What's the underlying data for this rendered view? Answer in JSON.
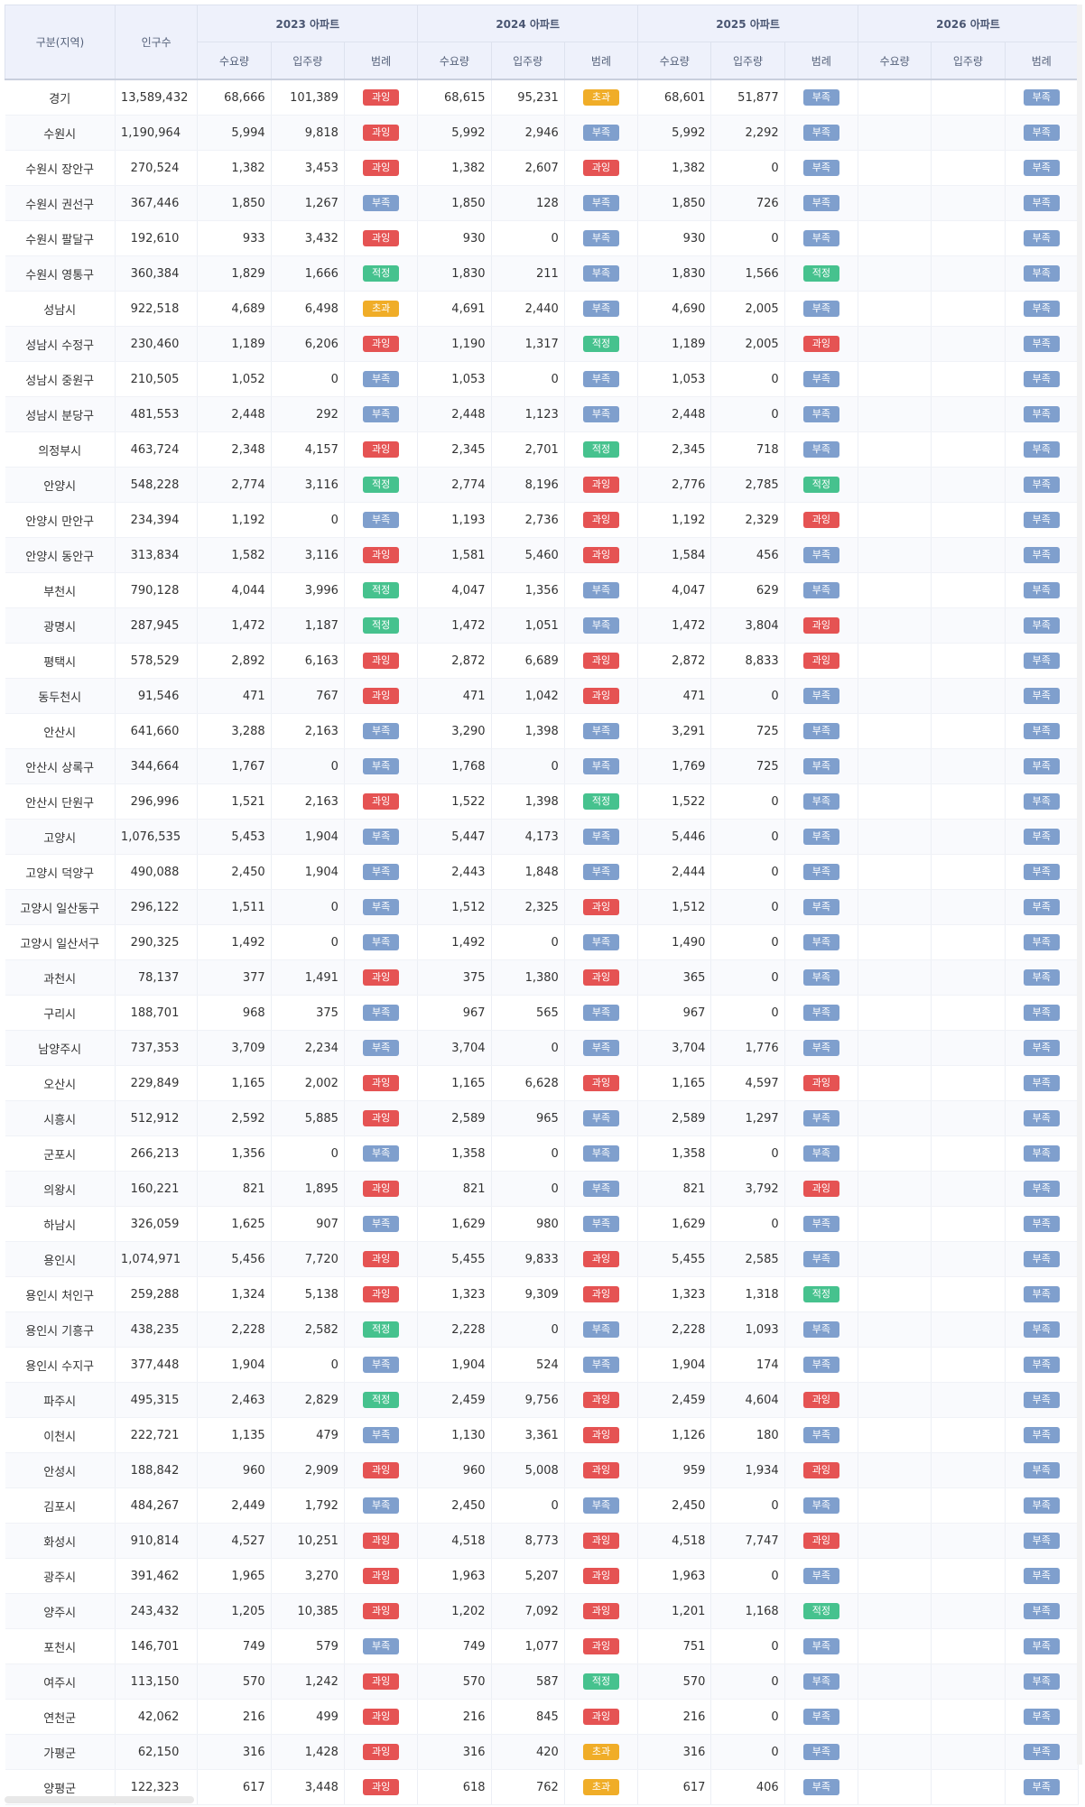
{
  "header": {
    "region": "구분(지역)",
    "population": "인구수",
    "years": [
      "2023 아파트",
      "2024 아파트",
      "2025 아파트",
      "2026 아파트"
    ],
    "sub": [
      "수요량",
      "입주량",
      "범례"
    ]
  },
  "legend_colors": {
    "과잉": "#e55353",
    "초과": "#f0ad28",
    "부족": "#7f9fcd",
    "적정": "#46c28e"
  },
  "rows": [
    [
      "경기",
      "13,589,432",
      "68,666",
      "101,389",
      "과잉",
      "68,615",
      "95,231",
      "초과",
      "68,601",
      "51,877",
      "부족",
      "",
      "",
      "부족"
    ],
    [
      "수원시",
      "1,190,964",
      "5,994",
      "9,818",
      "과잉",
      "5,992",
      "2,946",
      "부족",
      "5,992",
      "2,292",
      "부족",
      "",
      "",
      "부족"
    ],
    [
      "수원시 장안구",
      "270,524",
      "1,382",
      "3,453",
      "과잉",
      "1,382",
      "2,607",
      "과잉",
      "1,382",
      "0",
      "부족",
      "",
      "",
      "부족"
    ],
    [
      "수원시 권선구",
      "367,446",
      "1,850",
      "1,267",
      "부족",
      "1,850",
      "128",
      "부족",
      "1,850",
      "726",
      "부족",
      "",
      "",
      "부족"
    ],
    [
      "수원시 팔달구",
      "192,610",
      "933",
      "3,432",
      "과잉",
      "930",
      "0",
      "부족",
      "930",
      "0",
      "부족",
      "",
      "",
      "부족"
    ],
    [
      "수원시 영통구",
      "360,384",
      "1,829",
      "1,666",
      "적정",
      "1,830",
      "211",
      "부족",
      "1,830",
      "1,566",
      "적정",
      "",
      "",
      "부족"
    ],
    [
      "성남시",
      "922,518",
      "4,689",
      "6,498",
      "초과",
      "4,691",
      "2,440",
      "부족",
      "4,690",
      "2,005",
      "부족",
      "",
      "",
      "부족"
    ],
    [
      "성남시 수정구",
      "230,460",
      "1,189",
      "6,206",
      "과잉",
      "1,190",
      "1,317",
      "적정",
      "1,189",
      "2,005",
      "과잉",
      "",
      "",
      "부족"
    ],
    [
      "성남시 중원구",
      "210,505",
      "1,052",
      "0",
      "부족",
      "1,053",
      "0",
      "부족",
      "1,053",
      "0",
      "부족",
      "",
      "",
      "부족"
    ],
    [
      "성남시 분당구",
      "481,553",
      "2,448",
      "292",
      "부족",
      "2,448",
      "1,123",
      "부족",
      "2,448",
      "0",
      "부족",
      "",
      "",
      "부족"
    ],
    [
      "의정부시",
      "463,724",
      "2,348",
      "4,157",
      "과잉",
      "2,345",
      "2,701",
      "적정",
      "2,345",
      "718",
      "부족",
      "",
      "",
      "부족"
    ],
    [
      "안양시",
      "548,228",
      "2,774",
      "3,116",
      "적정",
      "2,774",
      "8,196",
      "과잉",
      "2,776",
      "2,785",
      "적정",
      "",
      "",
      "부족"
    ],
    [
      "안양시 만안구",
      "234,394",
      "1,192",
      "0",
      "부족",
      "1,193",
      "2,736",
      "과잉",
      "1,192",
      "2,329",
      "과잉",
      "",
      "",
      "부족"
    ],
    [
      "안양시 동안구",
      "313,834",
      "1,582",
      "3,116",
      "과잉",
      "1,581",
      "5,460",
      "과잉",
      "1,584",
      "456",
      "부족",
      "",
      "",
      "부족"
    ],
    [
      "부천시",
      "790,128",
      "4,044",
      "3,996",
      "적정",
      "4,047",
      "1,356",
      "부족",
      "4,047",
      "629",
      "부족",
      "",
      "",
      "부족"
    ],
    [
      "광명시",
      "287,945",
      "1,472",
      "1,187",
      "적정",
      "1,472",
      "1,051",
      "부족",
      "1,472",
      "3,804",
      "과잉",
      "",
      "",
      "부족"
    ],
    [
      "평택시",
      "578,529",
      "2,892",
      "6,163",
      "과잉",
      "2,872",
      "6,689",
      "과잉",
      "2,872",
      "8,833",
      "과잉",
      "",
      "",
      "부족"
    ],
    [
      "동두천시",
      "91,546",
      "471",
      "767",
      "과잉",
      "471",
      "1,042",
      "과잉",
      "471",
      "0",
      "부족",
      "",
      "",
      "부족"
    ],
    [
      "안산시",
      "641,660",
      "3,288",
      "2,163",
      "부족",
      "3,290",
      "1,398",
      "부족",
      "3,291",
      "725",
      "부족",
      "",
      "",
      "부족"
    ],
    [
      "안산시 상록구",
      "344,664",
      "1,767",
      "0",
      "부족",
      "1,768",
      "0",
      "부족",
      "1,769",
      "725",
      "부족",
      "",
      "",
      "부족"
    ],
    [
      "안산시 단원구",
      "296,996",
      "1,521",
      "2,163",
      "과잉",
      "1,522",
      "1,398",
      "적정",
      "1,522",
      "0",
      "부족",
      "",
      "",
      "부족"
    ],
    [
      "고양시",
      "1,076,535",
      "5,453",
      "1,904",
      "부족",
      "5,447",
      "4,173",
      "부족",
      "5,446",
      "0",
      "부족",
      "",
      "",
      "부족"
    ],
    [
      "고양시 덕양구",
      "490,088",
      "2,450",
      "1,904",
      "부족",
      "2,443",
      "1,848",
      "부족",
      "2,444",
      "0",
      "부족",
      "",
      "",
      "부족"
    ],
    [
      "고양시 일산동구",
      "296,122",
      "1,511",
      "0",
      "부족",
      "1,512",
      "2,325",
      "과잉",
      "1,512",
      "0",
      "부족",
      "",
      "",
      "부족"
    ],
    [
      "고양시 일산서구",
      "290,325",
      "1,492",
      "0",
      "부족",
      "1,492",
      "0",
      "부족",
      "1,490",
      "0",
      "부족",
      "",
      "",
      "부족"
    ],
    [
      "과천시",
      "78,137",
      "377",
      "1,491",
      "과잉",
      "375",
      "1,380",
      "과잉",
      "365",
      "0",
      "부족",
      "",
      "",
      "부족"
    ],
    [
      "구리시",
      "188,701",
      "968",
      "375",
      "부족",
      "967",
      "565",
      "부족",
      "967",
      "0",
      "부족",
      "",
      "",
      "부족"
    ],
    [
      "남양주시",
      "737,353",
      "3,709",
      "2,234",
      "부족",
      "3,704",
      "0",
      "부족",
      "3,704",
      "1,776",
      "부족",
      "",
      "",
      "부족"
    ],
    [
      "오산시",
      "229,849",
      "1,165",
      "2,002",
      "과잉",
      "1,165",
      "6,628",
      "과잉",
      "1,165",
      "4,597",
      "과잉",
      "",
      "",
      "부족"
    ],
    [
      "시흥시",
      "512,912",
      "2,592",
      "5,885",
      "과잉",
      "2,589",
      "965",
      "부족",
      "2,589",
      "1,297",
      "부족",
      "",
      "",
      "부족"
    ],
    [
      "군포시",
      "266,213",
      "1,356",
      "0",
      "부족",
      "1,358",
      "0",
      "부족",
      "1,358",
      "0",
      "부족",
      "",
      "",
      "부족"
    ],
    [
      "의왕시",
      "160,221",
      "821",
      "1,895",
      "과잉",
      "821",
      "0",
      "부족",
      "821",
      "3,792",
      "과잉",
      "",
      "",
      "부족"
    ],
    [
      "하남시",
      "326,059",
      "1,625",
      "907",
      "부족",
      "1,629",
      "980",
      "부족",
      "1,629",
      "0",
      "부족",
      "",
      "",
      "부족"
    ],
    [
      "용인시",
      "1,074,971",
      "5,456",
      "7,720",
      "과잉",
      "5,455",
      "9,833",
      "과잉",
      "5,455",
      "2,585",
      "부족",
      "",
      "",
      "부족"
    ],
    [
      "용인시 처인구",
      "259,288",
      "1,324",
      "5,138",
      "과잉",
      "1,323",
      "9,309",
      "과잉",
      "1,323",
      "1,318",
      "적정",
      "",
      "",
      "부족"
    ],
    [
      "용인시 기흥구",
      "438,235",
      "2,228",
      "2,582",
      "적정",
      "2,228",
      "0",
      "부족",
      "2,228",
      "1,093",
      "부족",
      "",
      "",
      "부족"
    ],
    [
      "용인시 수지구",
      "377,448",
      "1,904",
      "0",
      "부족",
      "1,904",
      "524",
      "부족",
      "1,904",
      "174",
      "부족",
      "",
      "",
      "부족"
    ],
    [
      "파주시",
      "495,315",
      "2,463",
      "2,829",
      "적정",
      "2,459",
      "9,756",
      "과잉",
      "2,459",
      "4,604",
      "과잉",
      "",
      "",
      "부족"
    ],
    [
      "이천시",
      "222,721",
      "1,135",
      "479",
      "부족",
      "1,130",
      "3,361",
      "과잉",
      "1,126",
      "180",
      "부족",
      "",
      "",
      "부족"
    ],
    [
      "안성시",
      "188,842",
      "960",
      "2,909",
      "과잉",
      "960",
      "5,008",
      "과잉",
      "959",
      "1,934",
      "과잉",
      "",
      "",
      "부족"
    ],
    [
      "김포시",
      "484,267",
      "2,449",
      "1,792",
      "부족",
      "2,450",
      "0",
      "부족",
      "2,450",
      "0",
      "부족",
      "",
      "",
      "부족"
    ],
    [
      "화성시",
      "910,814",
      "4,527",
      "10,251",
      "과잉",
      "4,518",
      "8,773",
      "과잉",
      "4,518",
      "7,747",
      "과잉",
      "",
      "",
      "부족"
    ],
    [
      "광주시",
      "391,462",
      "1,965",
      "3,270",
      "과잉",
      "1,963",
      "5,207",
      "과잉",
      "1,963",
      "0",
      "부족",
      "",
      "",
      "부족"
    ],
    [
      "양주시",
      "243,432",
      "1,205",
      "10,385",
      "과잉",
      "1,202",
      "7,092",
      "과잉",
      "1,201",
      "1,168",
      "적정",
      "",
      "",
      "부족"
    ],
    [
      "포천시",
      "146,701",
      "749",
      "579",
      "부족",
      "749",
      "1,077",
      "과잉",
      "751",
      "0",
      "부족",
      "",
      "",
      "부족"
    ],
    [
      "여주시",
      "113,150",
      "570",
      "1,242",
      "과잉",
      "570",
      "587",
      "적정",
      "570",
      "0",
      "부족",
      "",
      "",
      "부족"
    ],
    [
      "연천군",
      "42,062",
      "216",
      "499",
      "과잉",
      "216",
      "845",
      "과잉",
      "216",
      "0",
      "부족",
      "",
      "",
      "부족"
    ],
    [
      "가평군",
      "62,150",
      "316",
      "1,428",
      "과잉",
      "316",
      "420",
      "초과",
      "316",
      "0",
      "부족",
      "",
      "",
      "부족"
    ],
    [
      "양평군",
      "122,323",
      "617",
      "3,448",
      "과잉",
      "618",
      "762",
      "초과",
      "617",
      "406",
      "부족",
      "",
      "",
      "부족"
    ]
  ]
}
